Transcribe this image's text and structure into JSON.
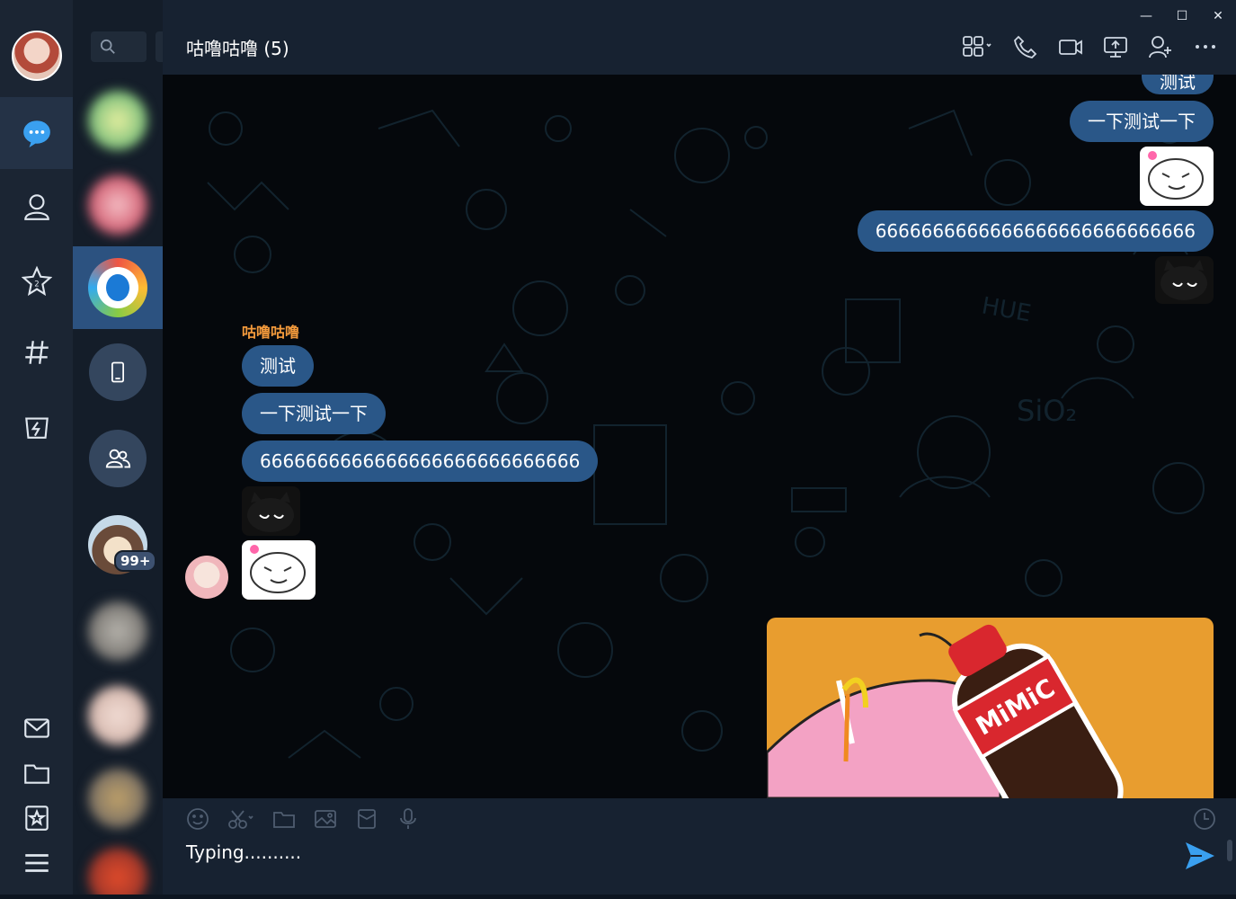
{
  "window": {
    "minimize": "—",
    "maximize": "☐",
    "close": "✕"
  },
  "chat": {
    "title": "咕噜咕噜 (5)",
    "outgoing": [
      "测试",
      "一下测试一下",
      "6666666666666666666666666666"
    ],
    "incoming_sender": "咕噜咕噜",
    "incoming": [
      "测试",
      "一下测试一下",
      "6666666666666666666666666666"
    ],
    "image_caption": "MiMiC"
  },
  "sidebar": {
    "unread_badge": "99+"
  },
  "composer": {
    "text": "Typing.........."
  },
  "colors": {
    "accent": "#2a5788",
    "sender": "#f39a3c",
    "send": "#3aa0f0"
  }
}
